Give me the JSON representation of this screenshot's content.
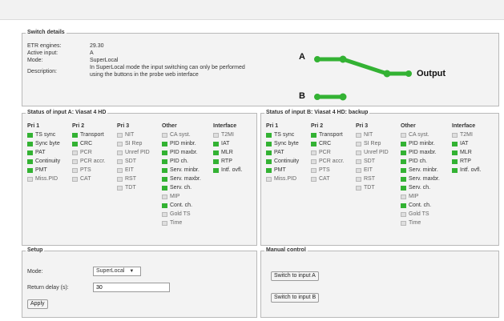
{
  "switch_details": {
    "legend": "Switch details",
    "rows": [
      {
        "label": "ETR engines:",
        "value": "29.30"
      },
      {
        "label": "Active input:",
        "value": "A"
      },
      {
        "label": "Mode:",
        "value": "SuperLocal"
      },
      {
        "label": "Description:",
        "value": "In SuperLocal mode the input switching can only be performed using the buttons in the probe web interface"
      }
    ],
    "diagram": {
      "label_a": "A",
      "label_b": "B",
      "label_output": "Output",
      "color": "#33b233"
    }
  },
  "input_a": {
    "legend": "Status of input A: Viasat 4 HD",
    "columns": [
      {
        "header": "Pri 1",
        "items": [
          {
            "label": "TS sync",
            "ok": true
          },
          {
            "label": "Sync byte",
            "ok": true
          },
          {
            "label": "PAT",
            "ok": true
          },
          {
            "label": "Continuity",
            "ok": true
          },
          {
            "label": "PMT",
            "ok": true
          },
          {
            "label": "Miss.PID",
            "ok": false
          }
        ]
      },
      {
        "header": "Pri 2",
        "items": [
          {
            "label": "Transport",
            "ok": true
          },
          {
            "label": "CRC",
            "ok": true
          },
          {
            "label": "PCR",
            "ok": false
          },
          {
            "label": "PCR accr.",
            "ok": false
          },
          {
            "label": "PTS",
            "ok": false
          },
          {
            "label": "CAT",
            "ok": false
          }
        ]
      },
      {
        "header": "Pri 3",
        "items": [
          {
            "label": "NIT",
            "ok": false
          },
          {
            "label": "SI Rep",
            "ok": false
          },
          {
            "label": "Unref PID",
            "ok": false
          },
          {
            "label": "SDT",
            "ok": false
          },
          {
            "label": "EIT",
            "ok": false
          },
          {
            "label": "RST",
            "ok": false
          },
          {
            "label": "TDT",
            "ok": false
          }
        ]
      },
      {
        "header": "Other",
        "items": [
          {
            "label": "CA syst.",
            "ok": false
          },
          {
            "label": "PID minbr.",
            "ok": true
          },
          {
            "label": "PID maxbr.",
            "ok": true
          },
          {
            "label": "PID ch.",
            "ok": true
          },
          {
            "label": "Serv. minbr.",
            "ok": true
          },
          {
            "label": "Serv. maxbr.",
            "ok": true
          },
          {
            "label": "Serv. ch.",
            "ok": true
          },
          {
            "label": "MIP",
            "ok": false
          },
          {
            "label": "Cont. ch.",
            "ok": true
          },
          {
            "label": "Gold TS",
            "ok": false
          },
          {
            "label": "Time",
            "ok": false
          }
        ]
      },
      {
        "header": "Interface",
        "items": [
          {
            "label": "T2MI",
            "ok": false
          },
          {
            "label": "IAT",
            "ok": true
          },
          {
            "label": "MLR",
            "ok": true
          },
          {
            "label": "RTP",
            "ok": true
          },
          {
            "label": "Intf. ovfl.",
            "ok": true
          }
        ]
      }
    ]
  },
  "input_b": {
    "legend": "Status of input B: Viasat 4 HD: backup",
    "columns": [
      {
        "header": "Pri 1",
        "items": [
          {
            "label": "TS sync",
            "ok": true
          },
          {
            "label": "Sync byte",
            "ok": true
          },
          {
            "label": "PAT",
            "ok": true
          },
          {
            "label": "Continuity",
            "ok": true
          },
          {
            "label": "PMT",
            "ok": true
          },
          {
            "label": "Miss.PID",
            "ok": false
          }
        ]
      },
      {
        "header": "Pri 2",
        "items": [
          {
            "label": "Transport",
            "ok": true
          },
          {
            "label": "CRC",
            "ok": true
          },
          {
            "label": "PCR",
            "ok": false
          },
          {
            "label": "PCR accr.",
            "ok": false
          },
          {
            "label": "PTS",
            "ok": false
          },
          {
            "label": "CAT",
            "ok": false
          }
        ]
      },
      {
        "header": "Pri 3",
        "items": [
          {
            "label": "NIT",
            "ok": false
          },
          {
            "label": "SI Rep",
            "ok": false
          },
          {
            "label": "Unref PID",
            "ok": false
          },
          {
            "label": "SDT",
            "ok": false
          },
          {
            "label": "EIT",
            "ok": false
          },
          {
            "label": "RST",
            "ok": false
          },
          {
            "label": "TDT",
            "ok": false
          }
        ]
      },
      {
        "header": "Other",
        "items": [
          {
            "label": "CA syst.",
            "ok": false
          },
          {
            "label": "PID minbr.",
            "ok": true
          },
          {
            "label": "PID maxbr.",
            "ok": true
          },
          {
            "label": "PID ch.",
            "ok": true
          },
          {
            "label": "Serv. minbr.",
            "ok": true
          },
          {
            "label": "Serv. maxbr.",
            "ok": true
          },
          {
            "label": "Serv. ch.",
            "ok": true
          },
          {
            "label": "MIP",
            "ok": false
          },
          {
            "label": "Cont. ch.",
            "ok": true
          },
          {
            "label": "Gold TS",
            "ok": false
          },
          {
            "label": "Time",
            "ok": false
          }
        ]
      },
      {
        "header": "Interface",
        "items": [
          {
            "label": "T2MI",
            "ok": false
          },
          {
            "label": "IAT",
            "ok": true
          },
          {
            "label": "MLR",
            "ok": true
          },
          {
            "label": "RTP",
            "ok": true
          },
          {
            "label": "Intf. ovfl.",
            "ok": true
          }
        ]
      }
    ]
  },
  "setup": {
    "legend": "Setup",
    "mode_label": "Mode:",
    "mode_value": "SuperLocal",
    "return_delay_label": "Return delay (s):",
    "return_delay_value": "30",
    "apply_label": "Apply"
  },
  "manual_control": {
    "legend": "Manual control",
    "switch_a_label": "Switch to input A",
    "switch_b_label": "Switch to input B"
  }
}
